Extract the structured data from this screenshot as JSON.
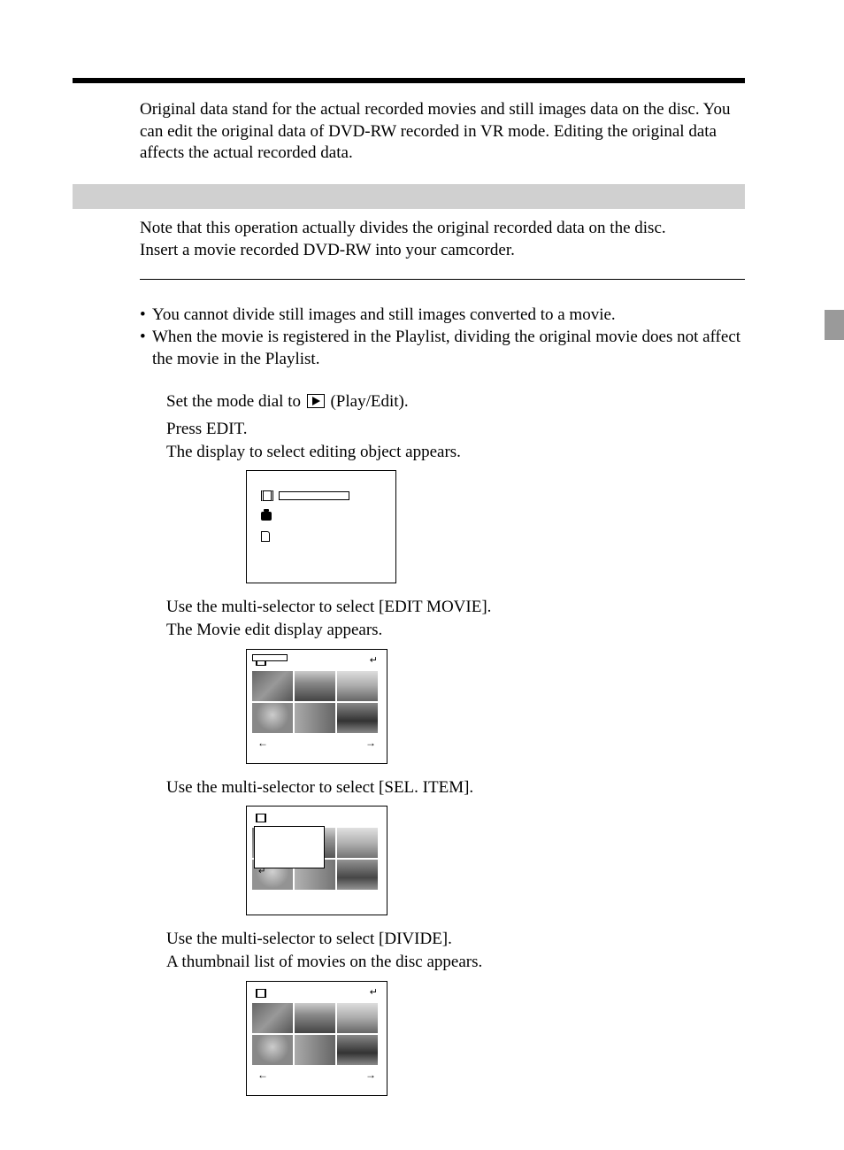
{
  "intro": "Original data stand for the actual recorded movies and still images data on the disc. You can edit the original data of DVD-RW recorded in VR mode. Editing the original data affects the actual recorded data.",
  "note_block": {
    "line1": "Note that this operation actually divides the original recorded data on the disc.",
    "line2": "Insert a movie recorded DVD-RW into your camcorder."
  },
  "bullets": [
    "You cannot divide still images and still images converted to a movie.",
    "When the movie is registered in the Playlist, dividing the original movie does not affect the movie in the Playlist."
  ],
  "steps": {
    "s1_pre": "Set the mode dial to ",
    "s1_post": " (Play/Edit).",
    "s2a": "Press EDIT.",
    "s2b": "The display to select editing object appears.",
    "s3a": "Use the multi-selector to select [EDIT MOVIE].",
    "s3b": "The Movie edit display appears.",
    "s4": "Use the multi-selector to select [SEL. ITEM].",
    "s5a": "Use the multi-selector to select [DIVIDE].",
    "s5b": "A thumbnail list of movies on the disc appears."
  },
  "glyphs": {
    "bullet": "•",
    "return": "↵",
    "larr": "←",
    "rarr": "→"
  }
}
